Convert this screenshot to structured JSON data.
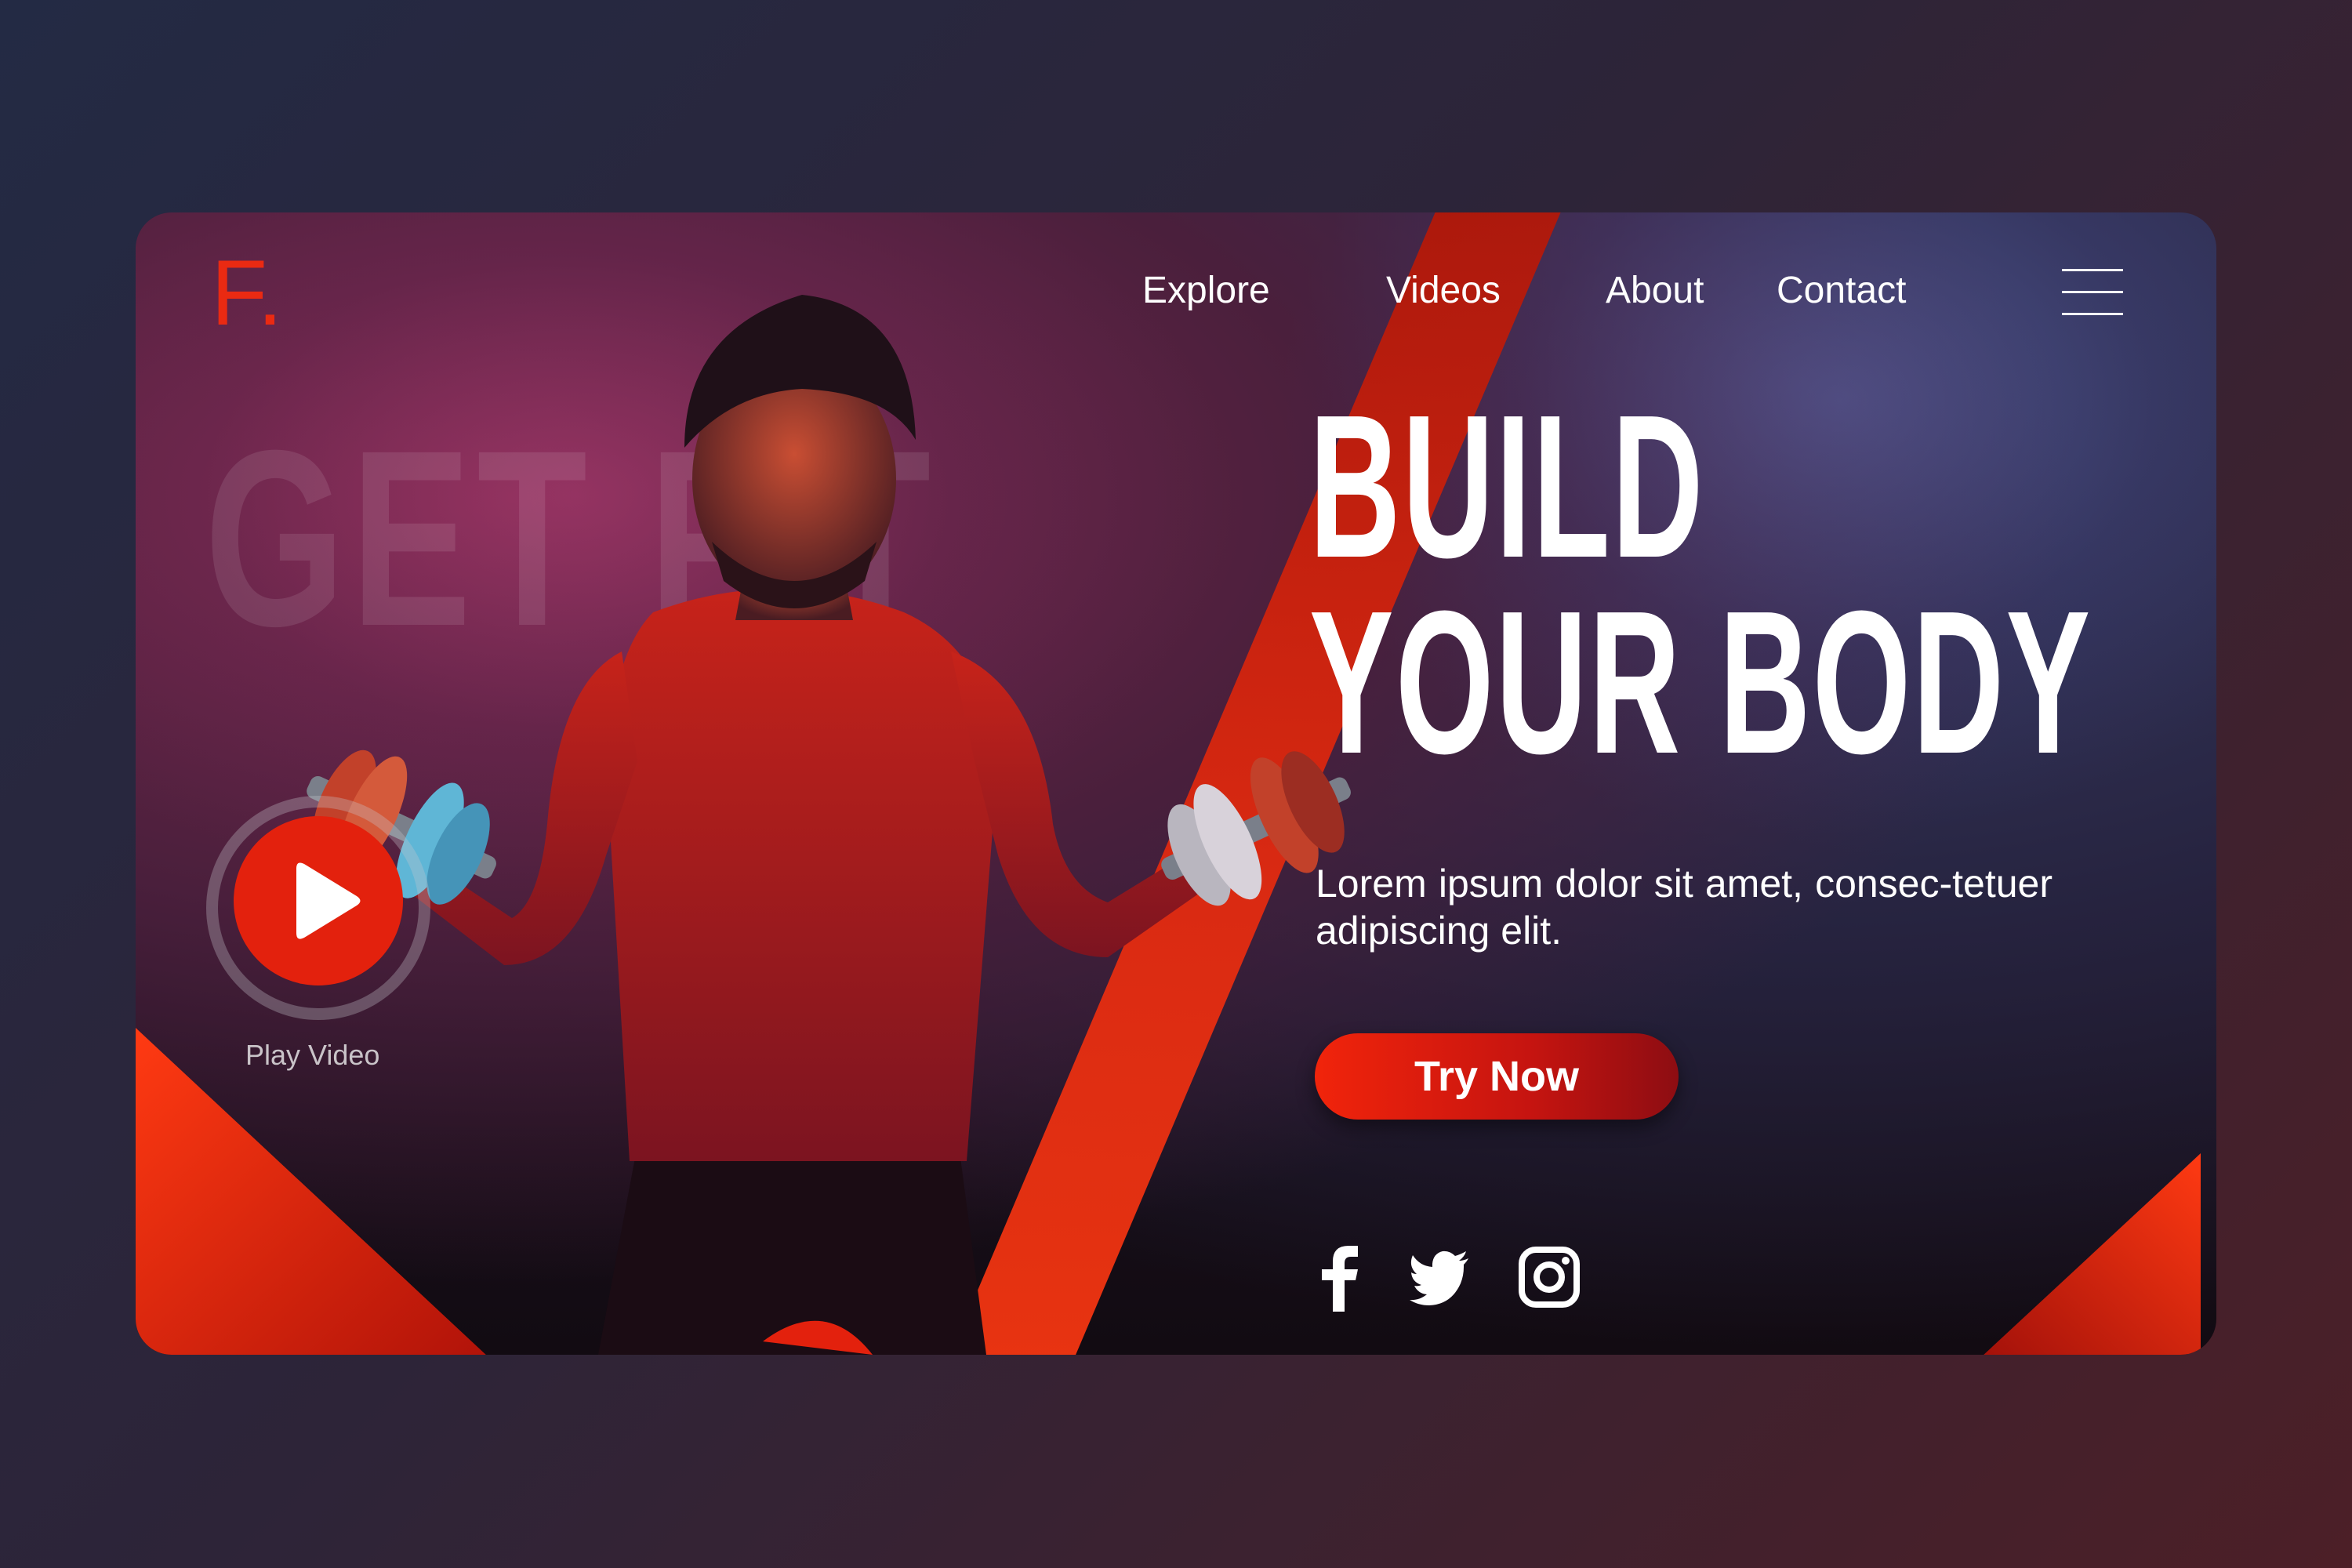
{
  "brand": {
    "logo_letter": "F",
    "logo_dot": ".",
    "accent_color": "#ea2a12"
  },
  "nav": {
    "items": [
      {
        "label": "Explore"
      },
      {
        "label": "Videos"
      },
      {
        "label": "About"
      },
      {
        "label": "Contact"
      }
    ],
    "menu_icon": "hamburger-icon"
  },
  "hero": {
    "background_text": "GET FIT",
    "headline_line1": "BUILD",
    "headline_line2": "YOUR BODY",
    "description": "Lorem ipsum dolor sit amet, consec-tetuer adipiscing elit.",
    "cta_label": "Try Now",
    "play_label": "Play Video"
  },
  "social": [
    {
      "icon": "facebook-icon"
    },
    {
      "icon": "twitter-icon"
    },
    {
      "icon": "instagram-icon"
    }
  ],
  "colors": {
    "cta_start": "#f1240b",
    "cta_end": "#8d0d12",
    "text": "#ffffff"
  }
}
